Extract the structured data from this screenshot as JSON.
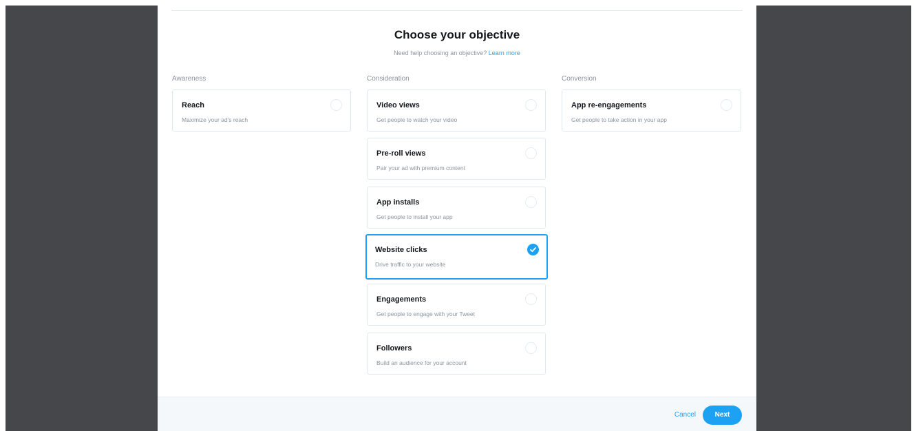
{
  "header": {
    "title": "Choose your objective",
    "help_text": "Need help choosing an objective?",
    "help_link": "Learn more"
  },
  "columns": [
    {
      "label": "Awareness",
      "objectives": [
        {
          "title": "Reach",
          "description": "Maximize your ad's reach",
          "selected": false
        }
      ]
    },
    {
      "label": "Consideration",
      "objectives": [
        {
          "title": "Video views",
          "description": "Get people to watch your video",
          "selected": false
        },
        {
          "title": "Pre-roll views",
          "description": "Pair your ad with premium content",
          "selected": false
        },
        {
          "title": "App installs",
          "description": "Get people to install your app",
          "selected": false
        },
        {
          "title": "Website clicks",
          "description": "Drive traffic to your website",
          "selected": true
        },
        {
          "title": "Engagements",
          "description": "Get people to engage with your Tweet",
          "selected": false
        },
        {
          "title": "Followers",
          "description": "Build an audience for your account",
          "selected": false
        }
      ]
    },
    {
      "label": "Conversion",
      "objectives": [
        {
          "title": "App re-engagements",
          "description": "Get people to take action in your app",
          "selected": false
        }
      ]
    }
  ],
  "footer": {
    "cancel_label": "Cancel",
    "next_label": "Next"
  },
  "colors": {
    "accent": "#1da1f2",
    "backdrop": "#46474a",
    "footer_bg": "#f5f8fa"
  },
  "icons": {
    "selected_radio": "check-icon",
    "unselected_radio": "radio-empty-icon"
  }
}
